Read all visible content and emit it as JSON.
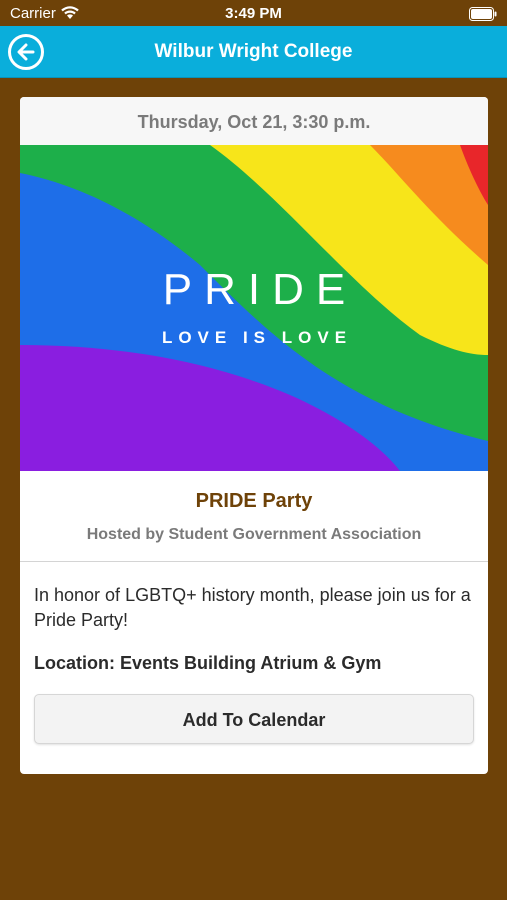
{
  "status_bar": {
    "carrier": "Carrier",
    "time": "3:49 PM"
  },
  "nav": {
    "title": "Wilbur Wright College",
    "back_icon": "back-arrow-circle-icon"
  },
  "event": {
    "date": "Thursday, Oct 21, 3:30 p.m.",
    "banner": {
      "title": "PRIDE",
      "subtitle": "LOVE IS LOVE"
    },
    "title": "PRIDE Party",
    "host": "Hosted by Student Government Association",
    "description": "In honor of LGBTQ+ history month, please join us for a Pride Party!",
    "location": "Location: Events Building Atrium & Gym",
    "add_to_calendar_label": "Add To Calendar"
  },
  "colors": {
    "background": "#6e4208",
    "nav_bar": "#0aaedb",
    "event_title": "#6e4208",
    "rainbow": [
      "#e8262a",
      "#f68b1e",
      "#f7e51a",
      "#1daf4a",
      "#1e6ee8",
      "#8a1ee0"
    ]
  }
}
